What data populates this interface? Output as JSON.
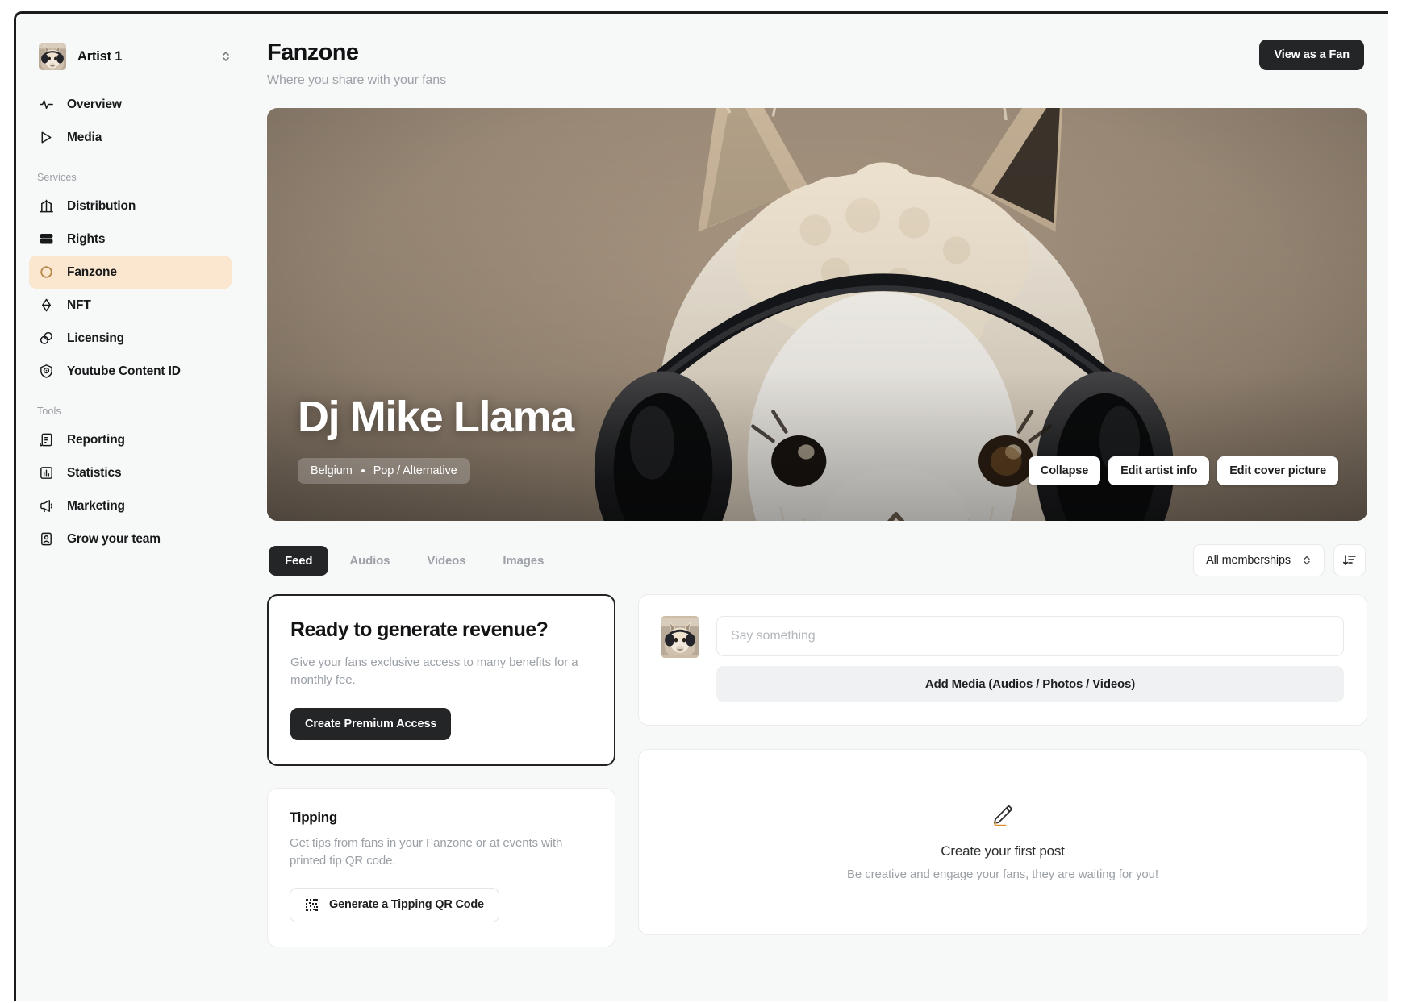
{
  "app": {
    "artist_switcher": {
      "name": "Artist 1",
      "icon": "llama-avatar-icon",
      "chevron": "chevron-up-down-icon"
    }
  },
  "sidebar": {
    "primary": [
      {
        "label": "Overview",
        "icon": "activity-pulse-icon",
        "active": false
      },
      {
        "label": "Media",
        "icon": "play-triangle-icon",
        "active": false
      }
    ],
    "groups": [
      {
        "label": "Services",
        "items": [
          {
            "label": "Distribution",
            "icon": "distribution-icon",
            "active": false
          },
          {
            "label": "Rights",
            "icon": "rights-stack-icon",
            "active": false
          },
          {
            "label": "Fanzone",
            "icon": "fanzone-circle-icon",
            "active": true
          },
          {
            "label": "NFT",
            "icon": "nft-diamond-icon",
            "active": false
          },
          {
            "label": "Licensing",
            "icon": "licensing-rings-icon",
            "active": false
          },
          {
            "label": "Youtube Content ID",
            "icon": "youtube-content-id-icon",
            "active": false
          }
        ]
      },
      {
        "label": "Tools",
        "items": [
          {
            "label": "Reporting",
            "icon": "reporting-document-icon",
            "active": false
          },
          {
            "label": "Statistics",
            "icon": "statistics-bars-icon",
            "active": false
          },
          {
            "label": "Marketing",
            "icon": "megaphone-icon",
            "active": false
          },
          {
            "label": "Grow your team",
            "icon": "team-contact-icon",
            "active": false
          }
        ]
      }
    ]
  },
  "header": {
    "title": "Fanzone",
    "subtitle": "Where you share with your fans",
    "view_as_fan_label": "View as a Fan"
  },
  "hero": {
    "artist_name": "Dj Mike Llama",
    "country": "Belgium",
    "genre": "Pop / Alternative",
    "separator": "•",
    "actions": [
      {
        "label": "Collapse",
        "name": "collapse-button"
      },
      {
        "label": "Edit artist info",
        "name": "edit-artist-info-button"
      },
      {
        "label": "Edit cover picture",
        "name": "edit-cover-picture-button"
      }
    ],
    "image_alt": "llama-with-headphones-cover-photo"
  },
  "tabs": [
    {
      "label": "Feed",
      "active": true
    },
    {
      "label": "Audios",
      "active": false
    },
    {
      "label": "Videos",
      "active": false
    },
    {
      "label": "Images",
      "active": false
    }
  ],
  "filters": {
    "membership_select_value": "All memberships",
    "membership_chevron": "chevron-up-down-icon",
    "sort_icon": "sort-descending-icon"
  },
  "promo_card": {
    "title": "Ready to generate revenue?",
    "body": "Give your fans exclusive access to many benefits for a monthly fee.",
    "cta": "Create Premium Access"
  },
  "tipping_card": {
    "title": "Tipping",
    "body": "Get tips from fans in your Fanzone or at events with printed tip QR code.",
    "cta": "Generate a Tipping QR Code",
    "cta_icon": "qr-code-icon"
  },
  "composer": {
    "avatar_icon": "llama-avatar-icon",
    "placeholder": "Say something",
    "value": "",
    "add_media_label": "Add Media (Audios / Photos / Videos)"
  },
  "empty_state": {
    "icon": "pencil-write-icon",
    "title": "Create your first post",
    "subtitle": "Be creative and engage your fans, they are waiting for you!"
  },
  "colors": {
    "accent_peach": "#fbe6cf",
    "accent_gold": "#b5884a",
    "accent_orange": "#e0912f",
    "dark": "#232527",
    "page_bg": "#f7f8f8",
    "muted_text": "#9aa0a6"
  }
}
